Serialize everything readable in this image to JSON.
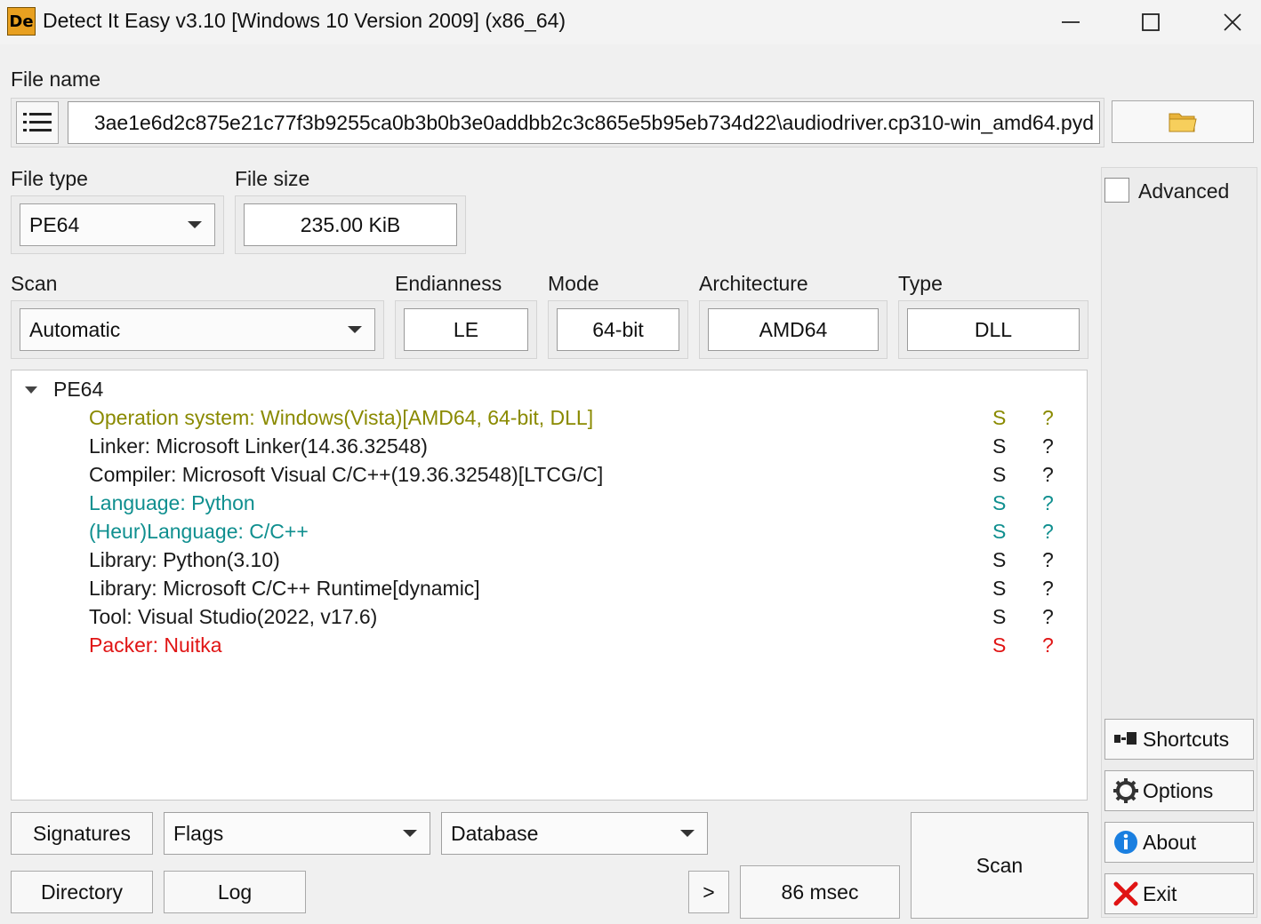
{
  "window": {
    "title": "Detect It Easy v3.10 [Windows 10 Version 2009] (x86_64)",
    "icon_text": "De"
  },
  "file_name": {
    "label": "File name",
    "value": "3ae1e6d2c875e21c77f3b9255ca0b3b0b3e0addbb2c3c865e5b95eb734d22\\audiodriver.cp310-win_amd64.pyd"
  },
  "file_type": {
    "label": "File type",
    "value": "PE64"
  },
  "file_size": {
    "label": "File size",
    "value": "235.00 KiB"
  },
  "scan_mode": {
    "label": "Scan",
    "value": "Automatic"
  },
  "endianness": {
    "label": "Endianness",
    "value": "LE"
  },
  "mode": {
    "label": "Mode",
    "value": "64-bit"
  },
  "architecture": {
    "label": "Architecture",
    "value": "AMD64"
  },
  "type": {
    "label": "Type",
    "value": "DLL"
  },
  "advanced": {
    "label": "Advanced",
    "checked": false
  },
  "results": {
    "root": "PE64",
    "items": [
      {
        "text": "Operation system: Windows(Vista)[AMD64, 64-bit, DLL]",
        "s": "S",
        "q": "?",
        "color": "#8a8a00"
      },
      {
        "text": "Linker: Microsoft Linker(14.36.32548)",
        "s": "S",
        "q": "?",
        "color": "#1a1a1a"
      },
      {
        "text": "Compiler: Microsoft Visual C/C++(19.36.32548)[LTCG/C]",
        "s": "S",
        "q": "?",
        "color": "#1a1a1a"
      },
      {
        "text": "Language: Python",
        "s": "S",
        "q": "?",
        "color": "#0f8f8f"
      },
      {
        "text": "(Heur)Language: C/C++",
        "s": "S",
        "q": "?",
        "color": "#0f8f8f"
      },
      {
        "text": "Library: Python(3.10)",
        "s": "S",
        "q": "?",
        "color": "#1a1a1a"
      },
      {
        "text": "Library: Microsoft C/C++ Runtime[dynamic]",
        "s": "S",
        "q": "?",
        "color": "#1a1a1a"
      },
      {
        "text": "Tool: Visual Studio(2022, v17.6)",
        "s": "S",
        "q": "?",
        "color": "#1a1a1a"
      },
      {
        "text": "Packer: Nuitka",
        "s": "S",
        "q": "?",
        "color": "#e01414"
      }
    ]
  },
  "bottom": {
    "signatures": "Signatures",
    "flags": "Flags",
    "database": "Database",
    "scan": "Scan",
    "directory": "Directory",
    "log": "Log",
    "more": ">",
    "elapsed": "86 msec"
  },
  "side": {
    "shortcuts": "Shortcuts",
    "options": "Options",
    "about": "About",
    "exit": "Exit"
  }
}
